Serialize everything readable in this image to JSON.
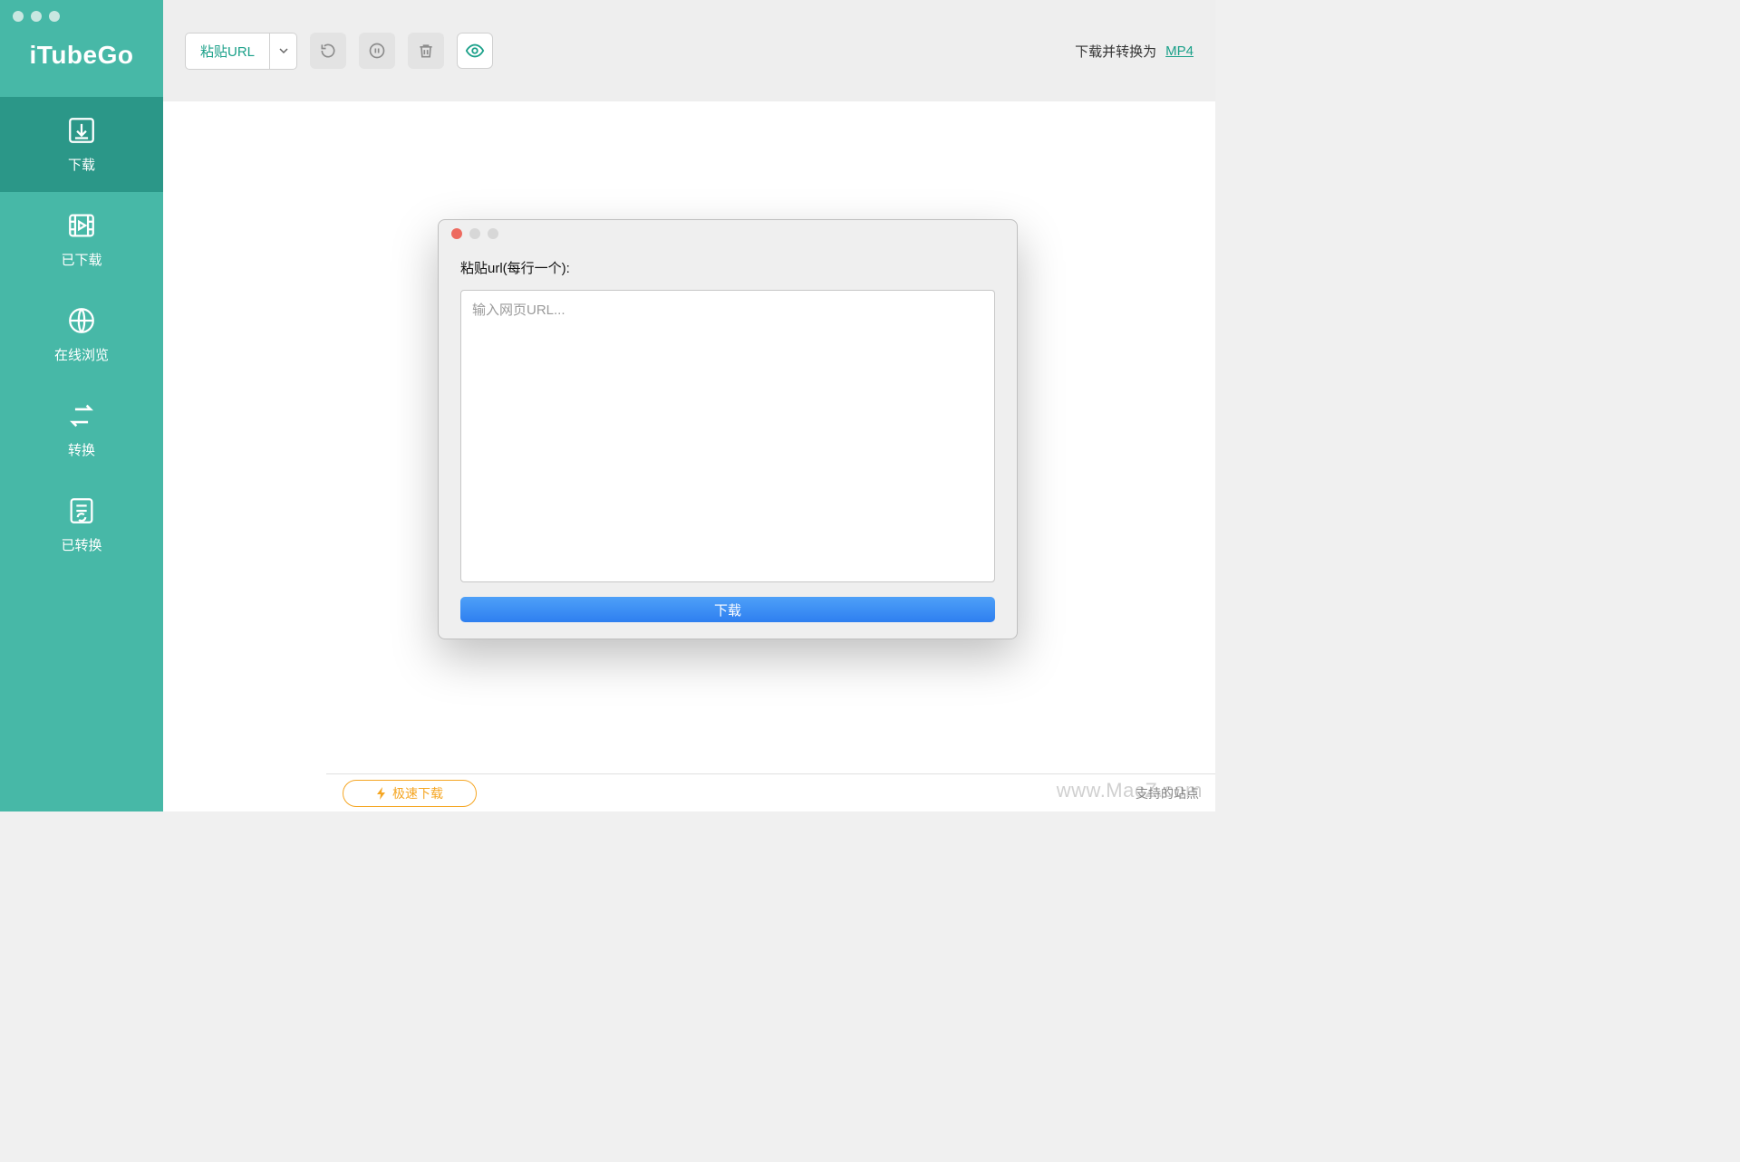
{
  "app": {
    "name": "iTubeGo"
  },
  "sidebar": {
    "items": [
      {
        "label": "下载"
      },
      {
        "label": "已下载"
      },
      {
        "label": "在线浏览"
      },
      {
        "label": "转换"
      },
      {
        "label": "已转换"
      }
    ]
  },
  "toolbar": {
    "paste_label": "粘贴URL",
    "convert_label": "下载并转换为",
    "format_link": "MP4"
  },
  "dialog": {
    "title": "粘贴url(每行一个):",
    "placeholder": "输入网页URL...",
    "download_btn": "下载"
  },
  "footer": {
    "turbo_label": "极速下载",
    "supported_label": "支持的站点"
  },
  "watermark": "www.MacZ.com"
}
